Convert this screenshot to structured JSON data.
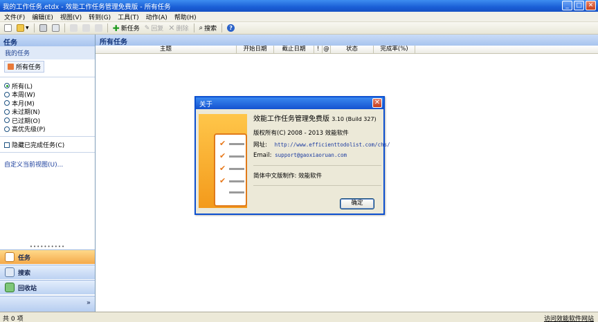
{
  "window": {
    "title": "我的工作任务.etdx - 效能工作任务管理免费版 - 所有任务",
    "min_glyph": "_",
    "max_glyph": "□",
    "close_glyph": "✕"
  },
  "menu": [
    "文件(F)",
    "编辑(E)",
    "视图(V)",
    "转到(G)",
    "工具(T)",
    "动作(A)",
    "帮助(H)"
  ],
  "toolbar": {
    "new_task": "新任务",
    "reply": "回复",
    "delete": "删除",
    "search": "搜索",
    "help_glyph": "?"
  },
  "left_pane": {
    "header": "任务",
    "section": "我的任务",
    "all_tasks_button": "所有任务",
    "filters": [
      "所有(L)",
      "本周(W)",
      "本月(M)",
      "未过期(N)",
      "已过期(O)",
      "高优先级(P)"
    ],
    "selected_filter": 0,
    "hide_completed": "隐藏已完成任务(C)",
    "customize_view": "自定义当前视图(U)..."
  },
  "nav": {
    "grip": "••••••••••",
    "tasks": "任务",
    "search": "搜索",
    "recycle": "回收站",
    "more_glyph": "»"
  },
  "main": {
    "header": "所有任务",
    "columns": [
      "主题",
      "开始日期",
      "截止日期",
      "!",
      "@",
      "状态",
      "完成率(%)"
    ]
  },
  "status": {
    "count": "共 0 项",
    "link": "访问效能软件网站"
  },
  "dialog": {
    "title": "关于",
    "close_glyph": "✕",
    "product": "效能工作任务管理免费版",
    "version": "3.10 (Build 327)",
    "copyright": "版权所有(C) 2008 - 2013 效能软件",
    "url_label": "网址:",
    "url": "http://www.efficienttodolist.com/chs/",
    "email_label": "Email:",
    "email": "support@gaoxiaoruan.com",
    "localization": "简体中文版制作: 效能软件",
    "ok": "确定"
  }
}
